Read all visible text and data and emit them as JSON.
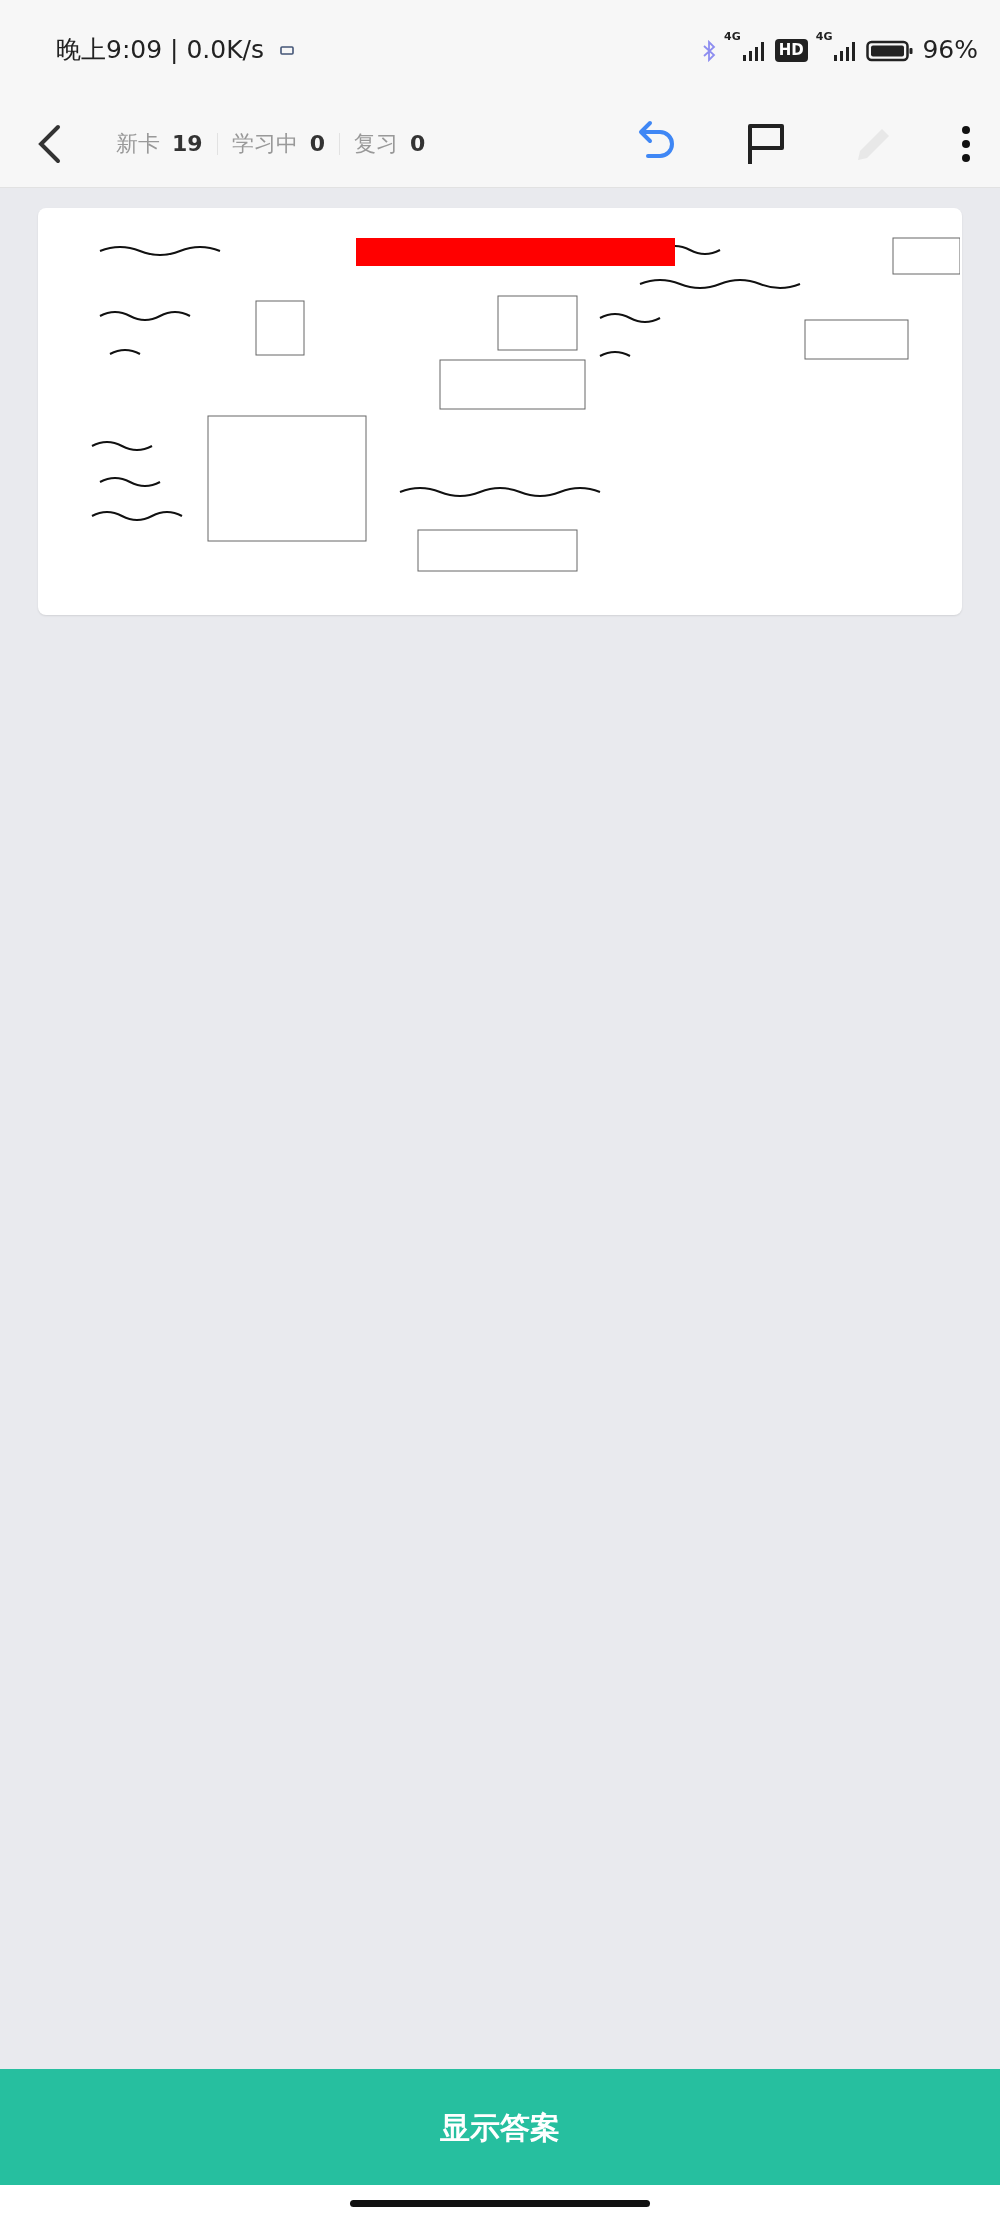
{
  "status_bar": {
    "clock": "晚上9:09 | 0.0K/s",
    "sim_1": "4G",
    "hd": "HD",
    "sim_2": "4G",
    "battery": "96%"
  },
  "toolbar": {
    "counters": [
      {
        "label": "新卡",
        "count": "19"
      },
      {
        "label": "学习中",
        "count": "0"
      },
      {
        "label": "复习",
        "count": "0"
      }
    ],
    "actions": [
      {
        "kind": "undo",
        "disabled": false
      },
      {
        "kind": "flag",
        "disabled": false
      },
      {
        "kind": "edit",
        "disabled": true
      },
      {
        "kind": "more",
        "disabled": false
      }
    ]
  },
  "answer_button": "显示答案"
}
